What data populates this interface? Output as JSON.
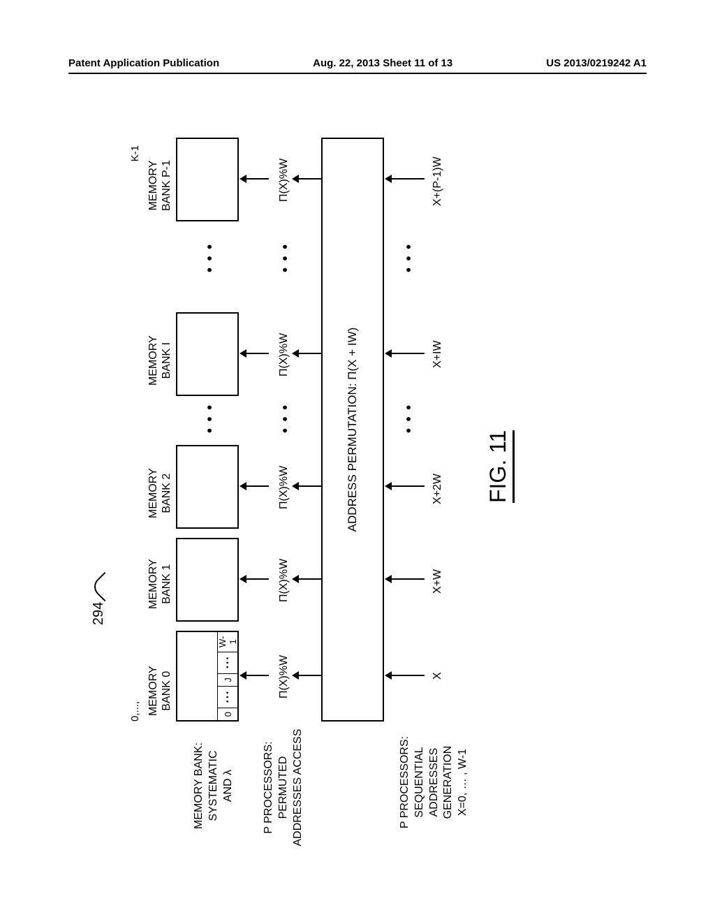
{
  "header": {
    "left": "Patent Application Publication",
    "center": "Aug. 22, 2013  Sheet 11 of 13",
    "right": "US 2013/0219242 A1"
  },
  "callout": "294",
  "topRange": "0,...,",
  "kLabel": "K-1",
  "banks": [
    {
      "label_line1": "MEMORY",
      "label_line2": "BANK 0"
    },
    {
      "label_line1": "MEMORY",
      "label_line2": "BANK 1"
    },
    {
      "label_line1": "MEMORY",
      "label_line2": "BANK 2"
    },
    {
      "label_line1": "MEMORY",
      "label_line2": "BANK I"
    },
    {
      "label_line1": "MEMORY",
      "label_line2": "BANK P-1"
    }
  ],
  "bank0cells": [
    "0",
    "• • •",
    "J",
    "• • •",
    "W-1"
  ],
  "leftLabels": {
    "memBank": [
      "MEMORY BANK:",
      "SYSTEMATIC",
      "AND λ"
    ],
    "permProc": [
      "P PROCESSORS:",
      "PERMUTED",
      "ADDRESSES ACCESS"
    ],
    "seqProc": [
      "P PROCESSORS:",
      "SEQUENTIAL",
      "ADDRESSES",
      "GENERATION",
      "X=0, … , W-1"
    ]
  },
  "permOutputs": [
    "Π(X)%W",
    "Π(X)%W",
    "Π(X)%W",
    "Π(X)%W",
    "Π(X)%W"
  ],
  "permBoxLabel": "ADDRESS PERMUTATION: Π(X + IW)",
  "seqInputs": [
    "X",
    "X+W",
    "X+2W",
    "X+IW",
    "X+(P-1)W"
  ],
  "figLabel": "FIG. 11",
  "ellipsis": "• • •"
}
